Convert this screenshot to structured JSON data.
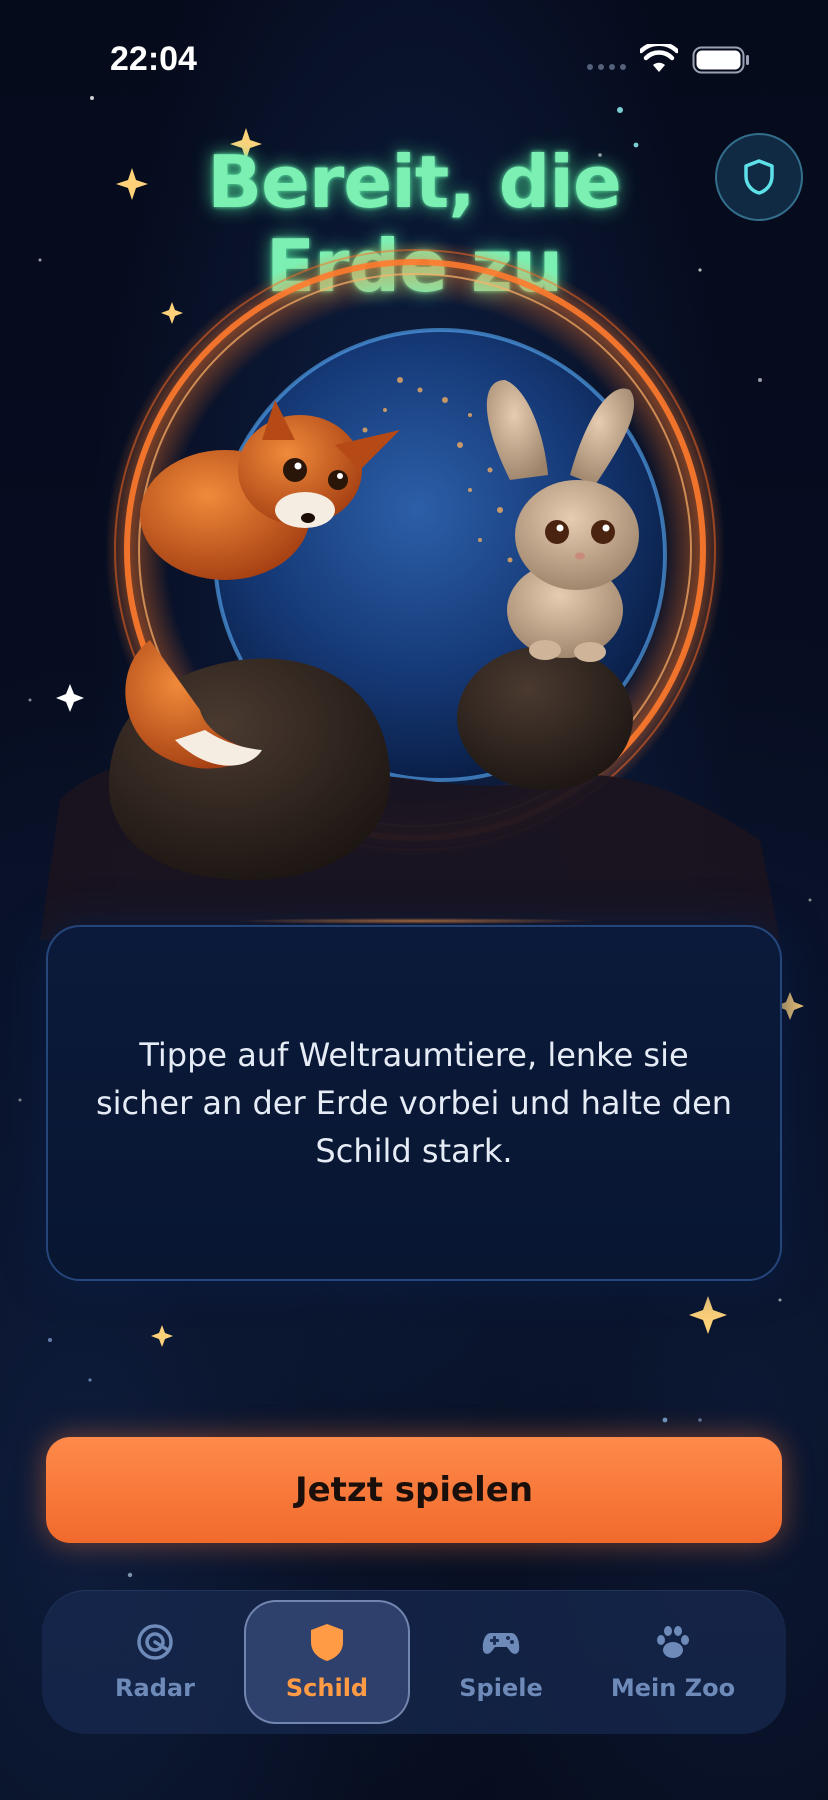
{
  "status_bar": {
    "time": "22:04",
    "icons": [
      "wifi-icon",
      "battery-icon"
    ]
  },
  "header": {
    "title": "Bereit, die Erde zu",
    "shield_icon": "shield-icon"
  },
  "card": {
    "text": "Tippe auf Weltraumtiere, lenke sie sicher an der Erde vorbei und halte den Schild stark."
  },
  "play_button": {
    "label": "Jetzt spielen"
  },
  "nav": {
    "items": [
      {
        "label": "Radar",
        "icon": "radar-icon",
        "active": false
      },
      {
        "label": "Schild",
        "icon": "shield-icon",
        "active": true
      },
      {
        "label": "Spiele",
        "icon": "gamepad-icon",
        "active": false
      },
      {
        "label": "Mein Zoo",
        "icon": "paw-icon",
        "active": false
      }
    ]
  },
  "colors": {
    "title": "#7cf0b2",
    "accent_orange": "#f47a3a",
    "nav_inactive": "#6e8ab8",
    "nav_active": "#ff9a45",
    "background": "#050a1a"
  }
}
